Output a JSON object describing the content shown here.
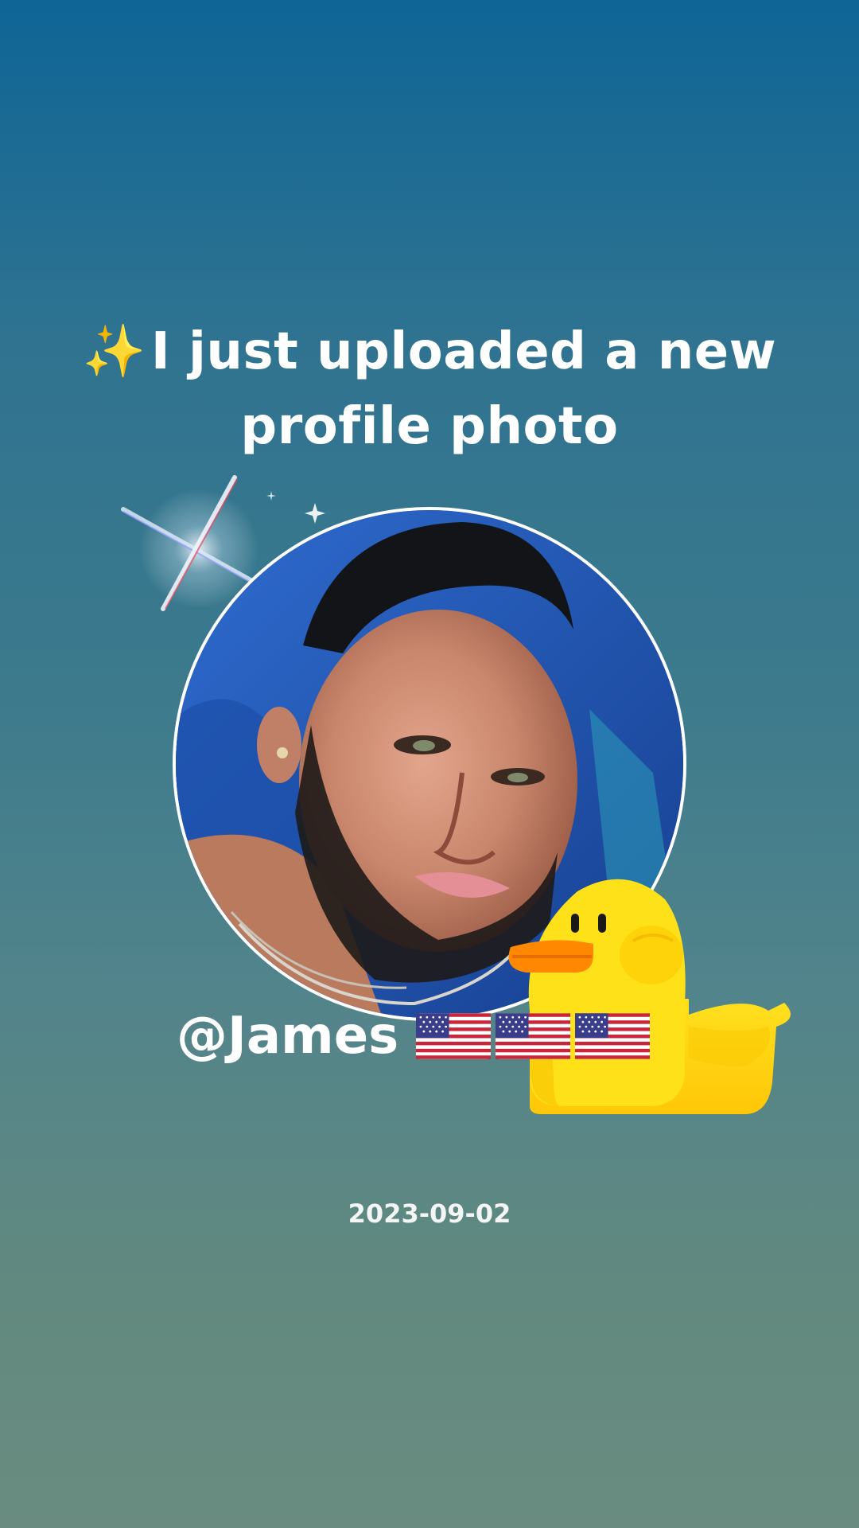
{
  "post": {
    "sparkles_emoji": "✨",
    "headline": "I just uploaded a new profile photo",
    "username": "@James",
    "flags": [
      "🇺🇸",
      "🇺🇸",
      "🇺🇸"
    ],
    "date": "2023-09-02"
  },
  "colors": {
    "background_top": "#0e6596",
    "background_bottom": "#6a8c80",
    "text": "#ffffff",
    "photo_border": "#ffffff",
    "duck_yellow": "#ffd21a",
    "duck_beak": "#ff8a00"
  },
  "icons": {
    "sparkles": "sparkles-icon",
    "duck": "duck-sticker-icon",
    "flag": "us-flag-icon",
    "glint": "star-glint-icon"
  }
}
